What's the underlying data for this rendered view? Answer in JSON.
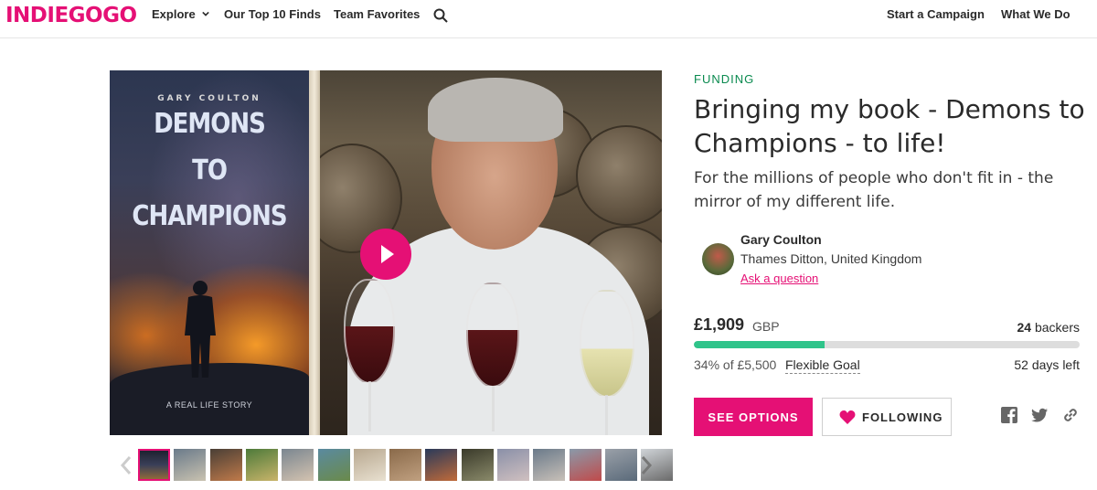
{
  "nav": {
    "logo": "INDIEGOGO",
    "explore": "Explore",
    "top10": "Our Top 10 Finds",
    "favorites": "Team Favorites",
    "start": "Start a Campaign",
    "what": "What We Do",
    "search_icon": "search-icon"
  },
  "book": {
    "author": "GARY COULTON",
    "title_line1": "DEMONS",
    "title_line2": "TO",
    "title_line3": "CHAMPIONS",
    "tagline": "A REAL LIFE STORY"
  },
  "campaign": {
    "status": "FUNDING",
    "title": "Bringing my book - Demons to Champions - to life!",
    "subtitle": "For the millions of people who don't fit in - the mirror of my different life."
  },
  "owner": {
    "name": "Gary Coulton",
    "location": "Thames Ditton, United Kingdom",
    "ask": "Ask a question"
  },
  "funding": {
    "raised": "£1,909",
    "currency": "GBP",
    "backers_count": "24",
    "backers_label": "backers",
    "progress_fraction": 0.34,
    "percent_text": "34% of £5,500",
    "flexible": "Flexible Goal",
    "days_left": "52 days left"
  },
  "actions": {
    "see_options": "SEE OPTIONS",
    "following": "FOLLOWING"
  },
  "share_icons": [
    "facebook-icon",
    "twitter-icon",
    "link-icon"
  ],
  "thumbnails_count": 15,
  "colors": {
    "brand": "#e51075",
    "progress": "#2fc48a",
    "funding_label": "#0a8a4f"
  }
}
